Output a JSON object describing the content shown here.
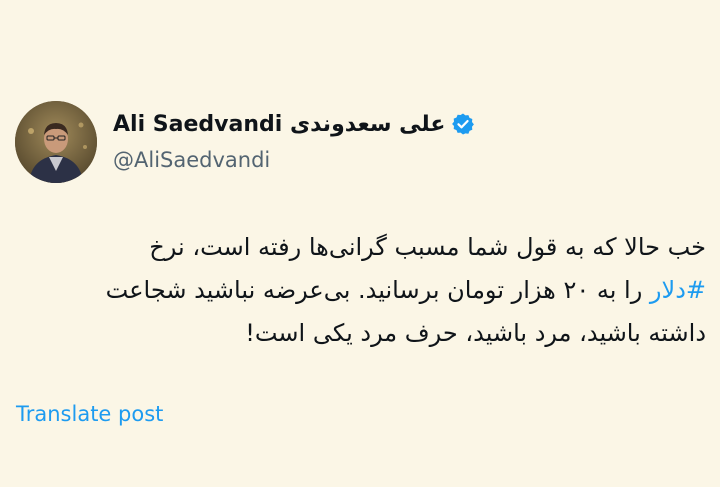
{
  "tweet": {
    "author": {
      "display_name": "Ali Saedvandi علی سعدوندی",
      "handle": "@AliSaedvandi",
      "verified_icon": "verified-badge-icon",
      "avatar": "avatar"
    },
    "text": {
      "line1": "خب حالا که به قول شما مسبب گرانی‌ها رفته است، نرخ",
      "line2_hashtag": "#دلار",
      "line2_rest": " را به ۲۰ هزار تومان برسانید. بی‌عرضه نباشید شجاعت",
      "line3": "داشته باشید، مرد باشید، حرف مرد یکی است!"
    },
    "translate_label": "Translate post"
  },
  "colors": {
    "background": "#fbf6e6",
    "text": "#0f1419",
    "secondary": "#536471",
    "accent": "#1d9bf0"
  }
}
